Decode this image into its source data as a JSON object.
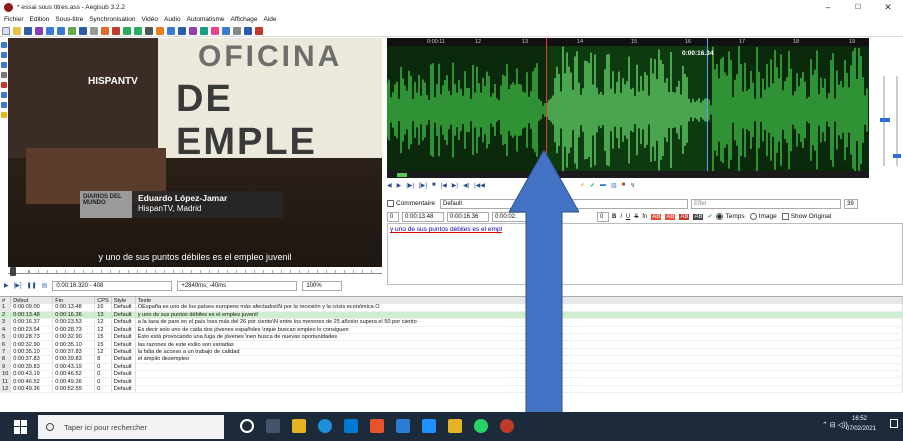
{
  "window": {
    "title": "* essai sous titres.ass - Aegisub 3.2.2",
    "min": "–",
    "max": "☐",
    "close": "✕"
  },
  "menu": [
    "Fichier",
    "Edition",
    "Sous-titre",
    "Synchronisation",
    "Vidéo",
    "Audio",
    "Automatisme",
    "Affichage",
    "Aide"
  ],
  "video": {
    "sign_line1": "OFICINA",
    "sign_line2": "DE EMPLE",
    "channel_logo": "HISPANTV",
    "badge": "DIARIOS DEL MUNDO",
    "person_name": "Eduardo López-Jamar",
    "person_place": "HispanTV, Madrid",
    "subtitle": "y uno de sus puntos débiles es el empleo juvenil",
    "frame_field": "0:00:16.320 - 408",
    "offset_field": "+2840ms; -40ms",
    "zoom_field": "100%"
  },
  "audio": {
    "timecode": "0:00:16.34",
    "ruler": [
      "0:00:11",
      "12",
      "13",
      "14",
      "15",
      "16",
      "17",
      "18",
      "19"
    ]
  },
  "edit": {
    "comment_label": "Commentaire",
    "style_value": "Default",
    "actor_placeholder": "Acteur",
    "effect_placeholder": "Effet",
    "layer": "0",
    "start": "0:00:13.48",
    "end": "0:00:16.36",
    "duration": "0:00:02.",
    "margin": "0",
    "margin_right": "39",
    "bold": "B",
    "italic": "I",
    "underline": "U",
    "strike": "S",
    "font": "fn",
    "ab1": "AB",
    "ab2": "AB",
    "ab3": "AB",
    "ab4": "AB",
    "radio_time": "Temps",
    "radio_image": "Image",
    "show_original": "Show Original",
    "text": "y uno de sus puntos débiles es el empl"
  },
  "grid": {
    "headers": [
      "#",
      "Début",
      "Fin",
      "CPS",
      "Style",
      "Texte"
    ],
    "rows": [
      [
        "1",
        "0:00:09.00",
        "0:00:13.48",
        "16",
        "Default",
        "OEspaña es uno de los países europeos más afectados\\N por la recesión y la crisis económica O"
      ],
      [
        "2",
        "0:00:13.48",
        "0:00:16.36",
        "13",
        "Default",
        "y uno de sus puntos débiles es el empleo juvenil"
      ],
      [
        "3",
        "0:00:16.37",
        "0:00:23.53",
        "12",
        "Default",
        "a la tasa de paro en el país \\nes más del 26 por ciento\\N entre los menores de 25 años\\n supera el 50 por ciento"
      ],
      [
        "4",
        "0:00:23.54",
        "0:00:28.73",
        "12",
        "Default",
        "Es decir solo uno de cada dos jóvenes españoles \\nque buscan empleo lo consiguen"
      ],
      [
        "5",
        "0:00:28.73",
        "0:00:32.90",
        "15",
        "Default",
        "Esto está provocando una fuga de jóvenes \\nen busca de nuevas oportunidades"
      ],
      [
        "6",
        "0:00:32.90",
        "0:00:35.10",
        "15",
        "Default",
        "las razones de este exilio son variadas"
      ],
      [
        "7",
        "0:00:35.10",
        "0:00:37.83",
        "12",
        "Default",
        "la falta de acceso a un trabajo de calidad"
      ],
      [
        "8",
        "0:00:37.83",
        "0:00:39.83",
        "8",
        "Default",
        "el ampilo desempleo"
      ],
      [
        "9",
        "0:00:39.83",
        "0:00:43.19",
        "0",
        "Default",
        ""
      ],
      [
        "10",
        "0:00:43.19",
        "0:00:46.52",
        "0",
        "Default",
        ""
      ],
      [
        "11",
        "0:00:46.52",
        "0:00:49.36",
        "0",
        "Default",
        ""
      ],
      [
        "12",
        "0:00:49.36",
        "0:00:52.59",
        "0",
        "Default",
        ""
      ]
    ]
  },
  "taskbar": {
    "search_placeholder": "Taper ici pour rechercher",
    "time": "16:52",
    "date": "07/02/2021"
  }
}
